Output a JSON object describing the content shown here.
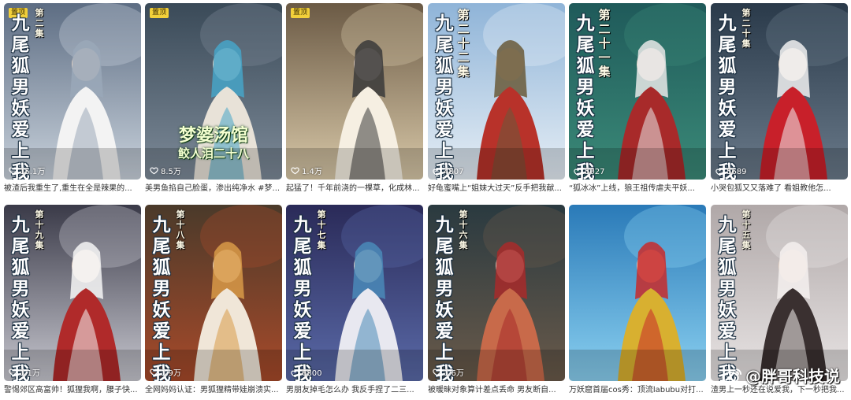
{
  "pin_label": "置顶",
  "watermark": "@胖哥科技说",
  "row1": [
    {
      "title_v": "九尾狐男妖爱上我",
      "episode": "第二集",
      "pinned": true,
      "likes": "15.1万",
      "caption": "被渣后我重生了,重生在全是辣果的..."
    },
    {
      "title_v": "",
      "episode": "",
      "pinned": true,
      "likes": "8.5万",
      "overlay_1": "梦婆汤馆",
      "overlay_2": "鲛人泪二十八",
      "caption": "美男鱼掐自己脸蛋，渗出纯净水 #梦..."
    },
    {
      "title_v": "",
      "episode": "",
      "pinned": true,
      "likes": "1.4万",
      "caption": "起猛了！千年前浇的一棵草，化成林..."
    },
    {
      "title_v": "九尾狐男妖爱上我",
      "episode": "第二十二集",
      "pinned": false,
      "likes": "4807",
      "caption": "好龟蜜嘴上“姐妹大过天”反手把我献..."
    },
    {
      "title_v": "九尾狐男妖爱上我",
      "episode": "第二十一集",
      "pinned": false,
      "likes": "5027",
      "caption": "“狐冰冰”上线，狼王祖传虐夫平妖..."
    },
    {
      "title_v": "九尾狐男妖爱上我",
      "episode": "第二十集",
      "pinned": false,
      "likes": "5689",
      "caption": "小哭包狐又又落难了 看姐教他怎..."
    }
  ],
  "row2": [
    {
      "title_v": "九尾狐男妖爱上我",
      "episode": "第十九集",
      "pinned": false,
      "likes": "1.1万",
      "caption": "警惕郊区高富帅！狐狸我啊，腰子快..."
    },
    {
      "title_v": "九尾狐男妖爱上我",
      "episode": "第十八集",
      "pinned": false,
      "likes": "1.9万",
      "caption": "全网妈妈认证：男狐狸精带娃崩溃实..."
    },
    {
      "title_v": "九尾狐男妖爱上我",
      "episode": "第十七集",
      "pinned": false,
      "likes": "6800",
      "caption": "男朋友掉毛怎么办 我反手捏了二三..."
    },
    {
      "title_v": "九尾狐男妖爱上我",
      "episode": "第十六集",
      "pinned": false,
      "likes": "1.6万",
      "caption": "被暖昧对象算计差点丢命 男友断自..."
    },
    {
      "title_v": "",
      "episode": "",
      "pinned": false,
      "likes": "",
      "caption": "万妖窟首届cos秀：顶流labubu对打..."
    },
    {
      "title_v": "九尾狐男妖爱上我",
      "episode": "第十五集",
      "pinned": false,
      "likes": "",
      "caption": "渣男上一秒还在说爱我，下一秒把我..."
    }
  ]
}
